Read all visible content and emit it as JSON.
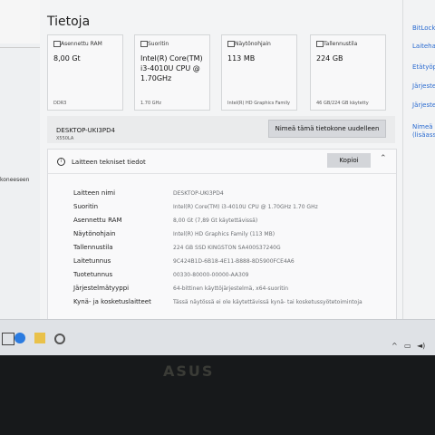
{
  "left_pane": {
    "partial_text": "koneeseen"
  },
  "page": {
    "title": "Tietoja"
  },
  "cards": [
    {
      "icon": "memory-icon",
      "label": "Asennettu RAM",
      "value": "8,00 Gt",
      "foot": "DDR3"
    },
    {
      "icon": "cpu-icon",
      "label": "Suoritin",
      "value": "Intel(R) Core(TM) i3-4010U CPU @ 1.70GHz",
      "foot": "1.70 GHz"
    },
    {
      "icon": "display-icon",
      "label": "Näytönohjain",
      "value": "113 MB",
      "foot": "Intel(R) HD Graphics Family"
    },
    {
      "icon": "storage-icon",
      "label": "Tallennustila",
      "value": "224 GB",
      "foot": "46 GB/224 GB käytetty"
    }
  ],
  "device": {
    "name": "DESKTOP-UKI3PD4",
    "model": "X550LA",
    "rename_label": "Nimeä tämä tietokone uudelleen"
  },
  "specs": {
    "title": "Laitteen tekniset tiedot",
    "copy_label": "Kopioi",
    "rows": [
      {
        "key": "Laitteen nimi",
        "value": "DESKTOP-UKI3PD4"
      },
      {
        "key": "Suoritin",
        "value": "Intel(R) Core(TM) i3-4010U CPU @ 1.70GHz   1.70 GHz"
      },
      {
        "key": "Asennettu RAM",
        "value": "8,00 Gt (7,89 Gt käytettävissä)"
      },
      {
        "key": "Näytönohjain",
        "value": "Intel(R) HD Graphics Family (113 MB)"
      },
      {
        "key": "Tallennustila",
        "value": "224 GB SSD KINGSTON SA400S37240G"
      },
      {
        "key": "Laitetunnus",
        "value": "9C424B1D-6B18-4E11-B888-8D5900FCE4A6"
      },
      {
        "key": "Tuotetunnus",
        "value": "00330-80000-00000-AA309"
      },
      {
        "key": "Järjestelmätyyppi",
        "value": "64-bittinen käyttöjärjestelmä, x64-suoritin"
      },
      {
        "key": "Kynä- ja kosketuslaitteet",
        "value": "Tässä näytössä ei ole käytettävissä kynä- tai kosketussyötetoimintoja"
      }
    ]
  },
  "right_pane": {
    "links": [
      "BitLock",
      "Laiteha",
      "Etätyöp",
      "Järjeste",
      "Järjeste",
      "Nimeä",
      "(lisäasse"
    ]
  },
  "taskbar": {
    "icons": [
      "start-icon",
      "search-icon",
      "edge-icon",
      "explorer-icon",
      "store-icon",
      "settings-icon"
    ]
  },
  "brand": {
    "logo": "ASUS"
  }
}
